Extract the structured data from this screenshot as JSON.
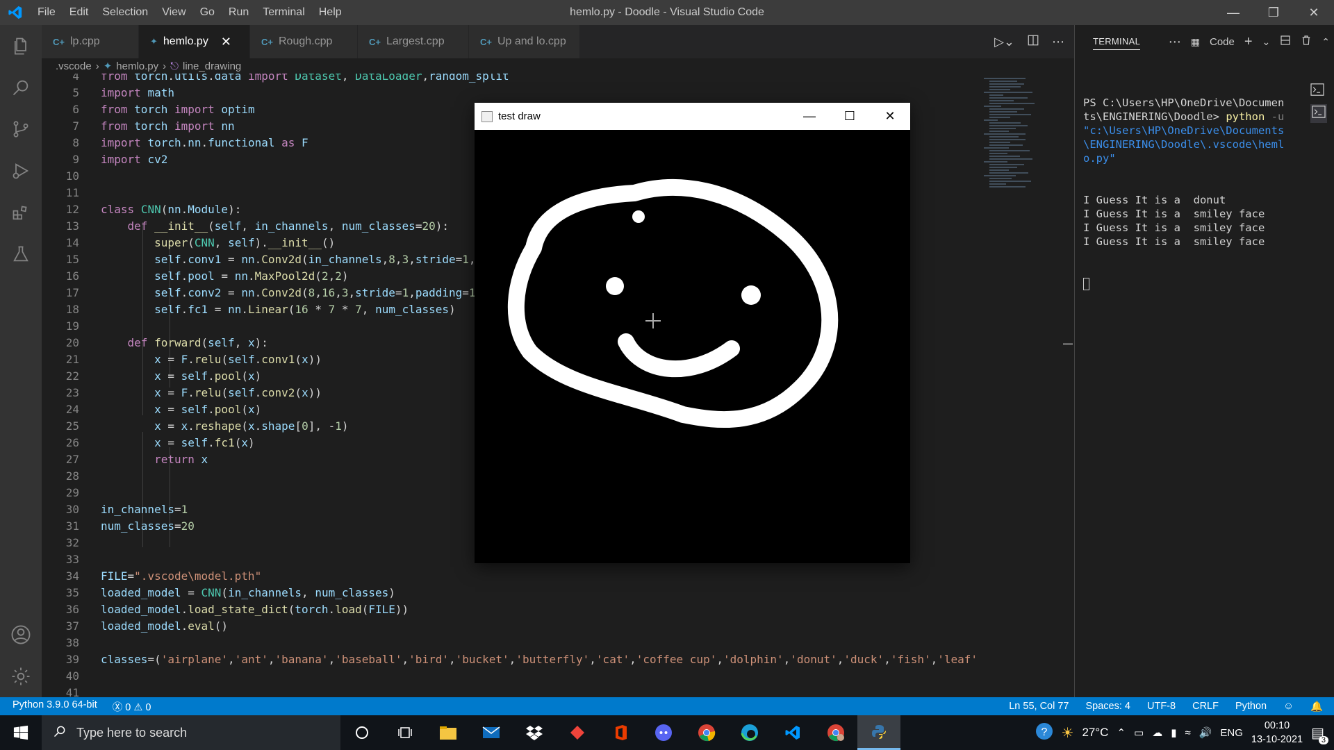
{
  "window": {
    "title": "hemlo.py - Doodle - Visual Studio Code",
    "menu": [
      "File",
      "Edit",
      "Selection",
      "View",
      "Go",
      "Run",
      "Terminal",
      "Help"
    ]
  },
  "tabs": [
    {
      "label": "lp.cpp",
      "lang": "cpp",
      "active": false
    },
    {
      "label": "hemlo.py",
      "lang": "py",
      "active": true
    },
    {
      "label": "Rough.cpp",
      "lang": "cpp",
      "active": false
    },
    {
      "label": "Largest.cpp",
      "lang": "cpp",
      "active": false
    },
    {
      "label": "Up and lo.cpp",
      "lang": "cpp",
      "active": false
    }
  ],
  "breadcrumb": {
    ".vscode": ".vscode",
    "file": "hemlo.py",
    "symbol": "line_drawing"
  },
  "code": [
    {
      "n": "4",
      "text": "from torch.utils.data import Dataset, DataLoader,random_split"
    },
    {
      "n": "5",
      "text": "import math"
    },
    {
      "n": "6",
      "text": "from torch import optim"
    },
    {
      "n": "7",
      "text": "from torch import nn"
    },
    {
      "n": "8",
      "text": "import torch.nn.functional as F"
    },
    {
      "n": "9",
      "text": "import cv2"
    },
    {
      "n": "10",
      "text": ""
    },
    {
      "n": "11",
      "text": ""
    },
    {
      "n": "12",
      "text": "class CNN(nn.Module):"
    },
    {
      "n": "13",
      "text": "    def __init__(self, in_channels, num_classes=20):"
    },
    {
      "n": "14",
      "text": "        super(CNN, self).__init__()"
    },
    {
      "n": "15",
      "text": "        self.conv1 = nn.Conv2d(in_channels,8,3,stride=1,"
    },
    {
      "n": "16",
      "text": "        self.pool = nn.MaxPool2d(2,2)"
    },
    {
      "n": "17",
      "text": "        self.conv2 = nn.Conv2d(8,16,3,stride=1,padding=1"
    },
    {
      "n": "18",
      "text": "        self.fc1 = nn.Linear(16 * 7 * 7, num_classes)"
    },
    {
      "n": "19",
      "text": ""
    },
    {
      "n": "20",
      "text": "    def forward(self, x):"
    },
    {
      "n": "21",
      "text": "        x = F.relu(self.conv1(x))"
    },
    {
      "n": "22",
      "text": "        x = self.pool(x)"
    },
    {
      "n": "23",
      "text": "        x = F.relu(self.conv2(x))"
    },
    {
      "n": "24",
      "text": "        x = self.pool(x)"
    },
    {
      "n": "25",
      "text": "        x = x.reshape(x.shape[0], -1)"
    },
    {
      "n": "26",
      "text": "        x = self.fc1(x)"
    },
    {
      "n": "27",
      "text": "        return x"
    },
    {
      "n": "28",
      "text": ""
    },
    {
      "n": "29",
      "text": ""
    },
    {
      "n": "30",
      "text": "in_channels=1"
    },
    {
      "n": "31",
      "text": "num_classes=20"
    },
    {
      "n": "32",
      "text": ""
    },
    {
      "n": "33",
      "text": ""
    },
    {
      "n": "34",
      "text": "FILE=\".vscode\\model.pth\""
    },
    {
      "n": "35",
      "text": "loaded_model = CNN(in_channels, num_classes)"
    },
    {
      "n": "36",
      "text": "loaded_model.load_state_dict(torch.load(FILE))"
    },
    {
      "n": "37",
      "text": "loaded_model.eval()"
    },
    {
      "n": "38",
      "text": ""
    },
    {
      "n": "39",
      "text": "classes=('airplane','ant','banana','baseball','bird','bucket','butterfly','cat','coffee cup','dolphin','donut','duck','fish','leaf'"
    },
    {
      "n": "40",
      "text": ""
    },
    {
      "n": "41",
      "text": ""
    }
  ],
  "terminal": {
    "tab": "TERMINAL",
    "profile": "Code",
    "prompt_path": "PS C:\\Users\\HP\\OneDrive\\Documents\\ENGINERING\\Doodle>",
    "command": "python",
    "flag": "-u",
    "arg": "\"c:\\Users\\HP\\OneDrive\\Documents\\ENGINERING\\Doodle\\.vscode\\hemlo.py\"",
    "output": [
      "I Guess It is a  donut",
      "I Guess It is a  smiley face",
      "I Guess It is a  smiley face",
      "I Guess It is a  smiley face"
    ]
  },
  "popup": {
    "title": "test draw"
  },
  "status": {
    "python": "Python 3.9.0 64-bit",
    "errors": "0",
    "warnings": "0",
    "position": "Ln 55, Col 77",
    "spaces": "Spaces: 4",
    "encoding": "UTF-8",
    "eol": "CRLF",
    "language": "Python"
  },
  "taskbar": {
    "search_placeholder": "Type here to search",
    "temperature": "27°C",
    "lang": "ENG",
    "time": "00:10",
    "date": "13-10-2021",
    "notifications": "3"
  },
  "colors": {
    "accent": "#007acc",
    "titlebar": "#3c3c3c",
    "editor_bg": "#1e1e1e",
    "activity_bar": "#333333"
  }
}
